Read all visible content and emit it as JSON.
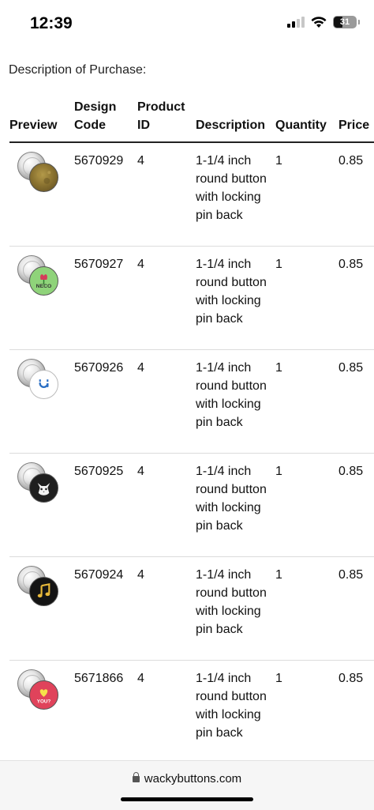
{
  "status_bar": {
    "time": "12:39",
    "battery": "31"
  },
  "section_title": "Description of Purchase:",
  "table": {
    "headers": {
      "preview": "Preview",
      "design_code": "Design Code",
      "product_id": "Product ID",
      "description": "Description",
      "quantity": "Quantity",
      "price": "Price"
    },
    "rows": [
      {
        "design_code": "5670929",
        "product_id": "4",
        "description": "1-1/4 inch round button with locking pin back",
        "quantity": "1",
        "price": "0.85",
        "preview_icon": "bronze-texture-icon"
      },
      {
        "design_code": "5670927",
        "product_id": "4",
        "description": "1-1/4 inch round button with locking pin back",
        "quantity": "1",
        "price": "0.85",
        "preview_icon": "flower-icon",
        "preview_text": "NECO"
      },
      {
        "design_code": "5670926",
        "product_id": "4",
        "description": "1-1/4 inch round button with locking pin back",
        "quantity": "1",
        "price": "0.85",
        "preview_icon": "face-icon"
      },
      {
        "design_code": "5670925",
        "product_id": "4",
        "description": "1-1/4 inch round button with locking pin back",
        "quantity": "1",
        "price": "0.85",
        "preview_icon": "cat-icon"
      },
      {
        "design_code": "5670924",
        "product_id": "4",
        "description": "1-1/4 inch round button with locking pin back",
        "quantity": "1",
        "price": "0.85",
        "preview_icon": "music-note-icon"
      },
      {
        "design_code": "5671866",
        "product_id": "4",
        "description": "1-1/4 inch round button with locking pin back",
        "quantity": "1",
        "price": "0.85",
        "preview_icon": "heart-icon",
        "preview_text": "YOU?"
      }
    ]
  },
  "browser": {
    "url": "wackybuttons.com"
  },
  "colors": {
    "header_rule": "#222222",
    "row_rule": "#dcdcdc",
    "url_bar": "#f6f6f6"
  }
}
